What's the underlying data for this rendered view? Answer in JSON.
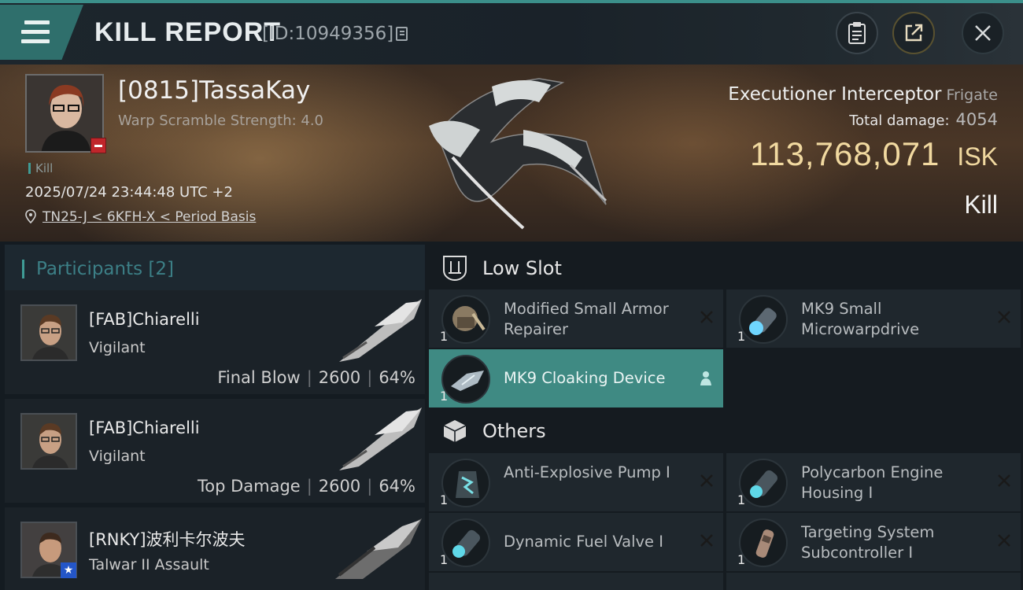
{
  "header": {
    "title": "KILL REPORT",
    "kill_id": "[ID:10949356]"
  },
  "victim": {
    "name": "[0815]TassaKay",
    "warp_scramble": "Warp Scramble Strength: 4.0",
    "tag": "Kill",
    "datetime": "2025/07/24 23:44:48 UTC +2",
    "location": "TN25-J < 6KFH-X < Period Basis"
  },
  "ship": {
    "name": "Executioner Interceptor",
    "class": "Frigate",
    "total_damage_label": "Total damage:",
    "total_damage": "4054",
    "isk_value": "113,768,071",
    "isk_unit": "ISK",
    "result": "Kill"
  },
  "participants": {
    "title": "Participants [2]",
    "items": [
      {
        "name": "[FAB]Chiarelli",
        "ship": "Vigilant",
        "role": "Final Blow",
        "damage": "2600",
        "percent": "64%"
      },
      {
        "name": "[FAB]Chiarelli",
        "ship": "Vigilant",
        "role": "Top Damage",
        "damage": "2600",
        "percent": "64%"
      },
      {
        "name": "[RNKY]波利卡尔波夫",
        "ship": "Talwar II Assault"
      }
    ]
  },
  "low_slot": {
    "title": "Low Slot",
    "items": [
      {
        "name": "Modified Small Armor Repairer",
        "qty": "1"
      },
      {
        "name": "MK9 Small Microwarpdrive",
        "qty": "1"
      },
      {
        "name": "MK9 Cloaking Device",
        "qty": "1"
      }
    ]
  },
  "others": {
    "title": "Others",
    "items": [
      {
        "name": "Anti-Explosive Pump I",
        "qty": "1"
      },
      {
        "name": "Polycarbon Engine Housing I",
        "qty": "1"
      },
      {
        "name": "Dynamic Fuel Valve I",
        "qty": "1"
      },
      {
        "name": "Targeting System Subcontroller I",
        "qty": "1"
      }
    ]
  },
  "colors": {
    "accent": "#3f9c96",
    "isk": "#f1d9a0",
    "selected": "#3f8a83",
    "corp_badge": "#c0262b"
  }
}
